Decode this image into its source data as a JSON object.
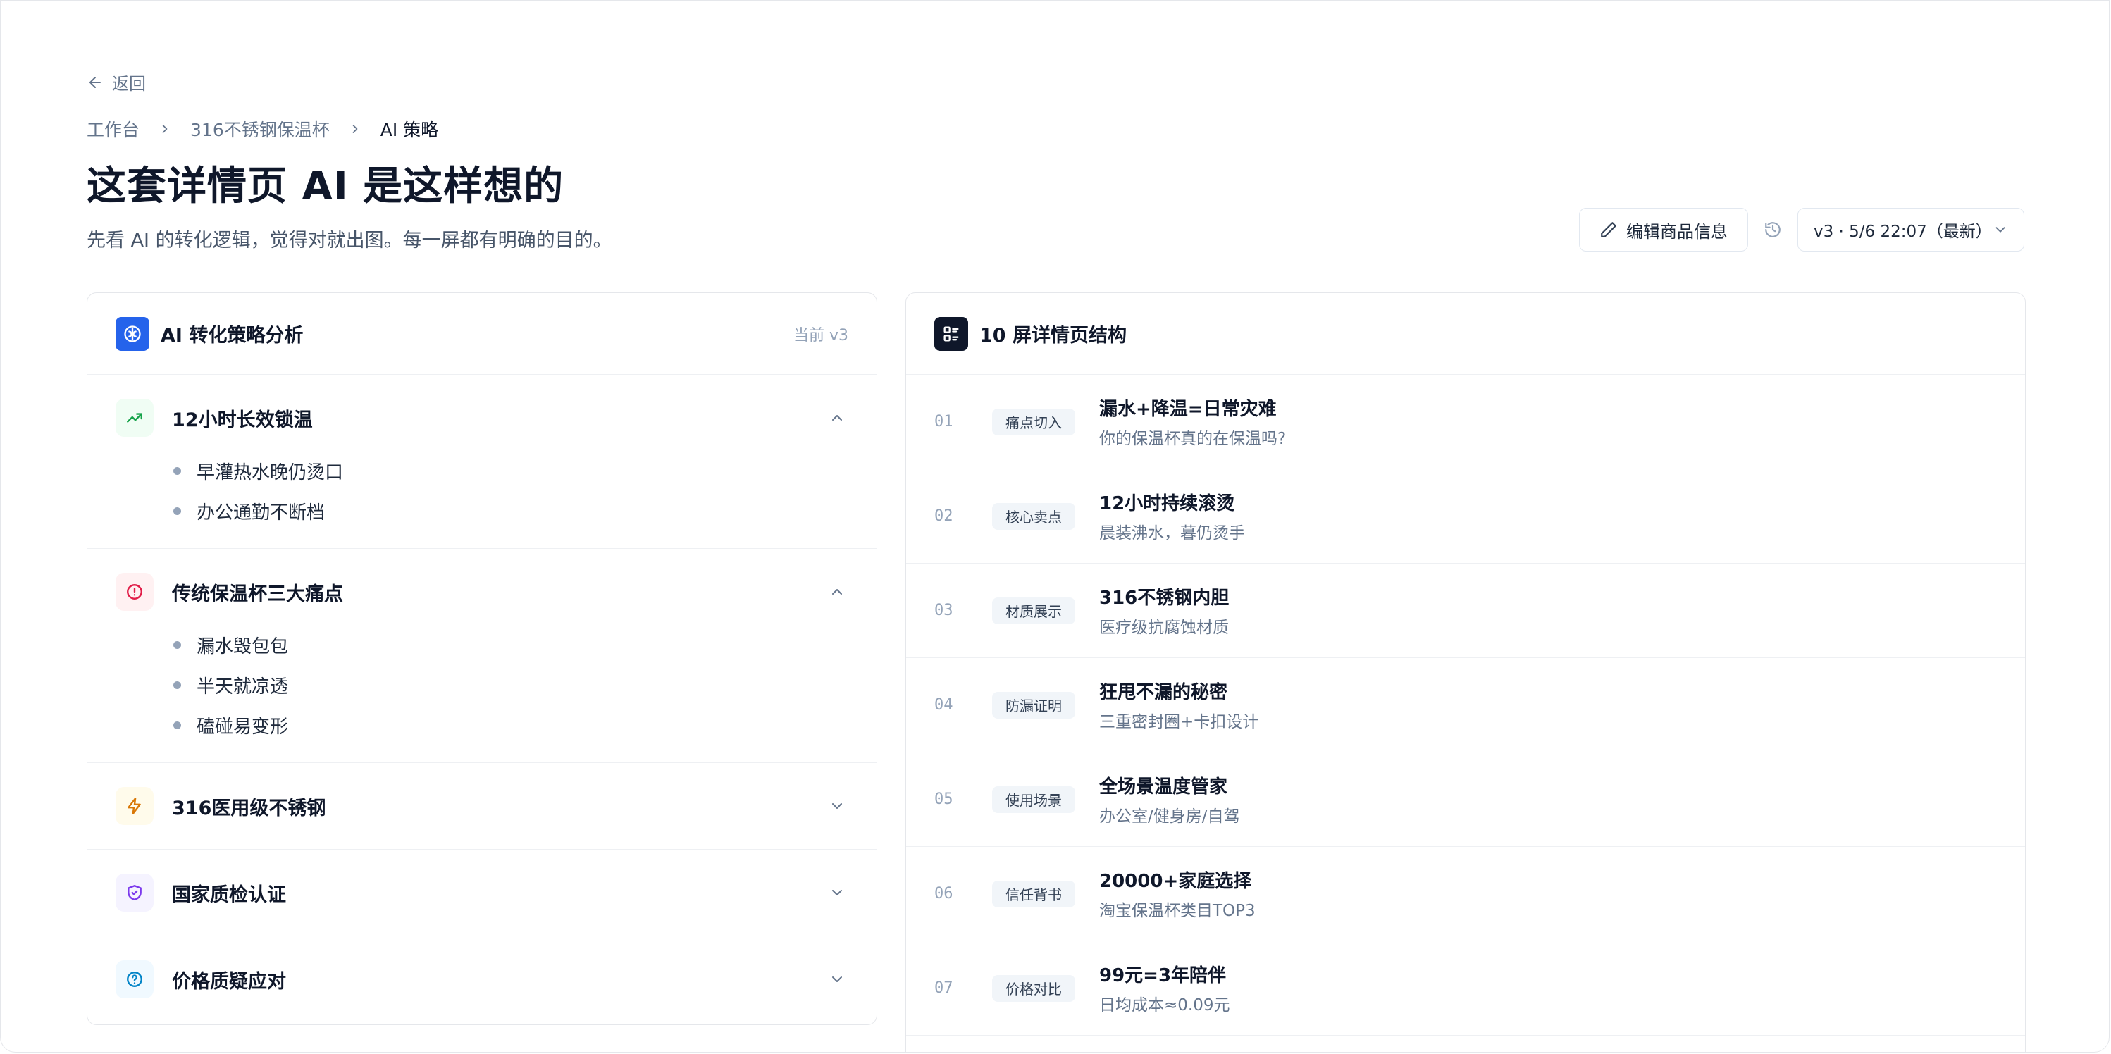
{
  "nav": {
    "back_label": "返回"
  },
  "breadcrumb": {
    "items": [
      "工作台",
      "316不锈钢保温杯",
      "AI 策略"
    ]
  },
  "header": {
    "title": "这套详情页 AI 是这样想的",
    "subtitle": "先看 AI 的转化逻辑，觉得对就出图。每一屏都有明确的目的。",
    "edit_button": "编辑商品信息",
    "version_select": "v3 · 5/6 22:07（最新）"
  },
  "strategy": {
    "title": "AI 转化策略分析",
    "version_tag": "当前 v3",
    "items": [
      {
        "title": "12小时长效锁温",
        "icon": "trending-up-icon",
        "expanded": true,
        "bullets": [
          "早灌热水晚仍烫口",
          "办公通勤不断档"
        ]
      },
      {
        "title": "传统保温杯三大痛点",
        "icon": "alert-circle-icon",
        "expanded": true,
        "bullets": [
          "漏水毁包包",
          "半天就凉透",
          "磕碰易变形"
        ]
      },
      {
        "title": "316医用级不锈钢",
        "icon": "zap-icon",
        "expanded": false,
        "bullets": []
      },
      {
        "title": "国家质检认证",
        "icon": "shield-check-icon",
        "expanded": false,
        "bullets": []
      },
      {
        "title": "价格质疑应对",
        "icon": "help-circle-icon",
        "expanded": false,
        "bullets": []
      }
    ]
  },
  "structure": {
    "title": "10 屏详情页结构",
    "rows": [
      {
        "num": "01",
        "tag": "痛点切入",
        "title": "漏水+降温=日常灾难",
        "desc": "你的保温杯真的在保温吗?"
      },
      {
        "num": "02",
        "tag": "核心卖点",
        "title": "12小时持续滚烫",
        "desc": "晨装沸水，暮仍烫手"
      },
      {
        "num": "03",
        "tag": "材质展示",
        "title": "316不锈钢内胆",
        "desc": "医疗级抗腐蚀材质"
      },
      {
        "num": "04",
        "tag": "防漏证明",
        "title": "狂甩不漏的秘密",
        "desc": "三重密封圈+卡扣设计"
      },
      {
        "num": "05",
        "tag": "使用场景",
        "title": "全场景温度管家",
        "desc": "办公室/健身房/自驾"
      },
      {
        "num": "06",
        "tag": "信任背书",
        "title": "20000+家庭选择",
        "desc": "淘宝保温杯类目TOP3"
      },
      {
        "num": "07",
        "tag": "价格对比",
        "title": "99元=3年陪伴",
        "desc": "日均成本≈0.09元"
      }
    ]
  },
  "colors": {
    "accent_blue": "#2563eb",
    "green": "#16a34a",
    "red": "#e11d48",
    "amber": "#d97706",
    "purple": "#7c3aed",
    "sky": "#0284c7"
  }
}
